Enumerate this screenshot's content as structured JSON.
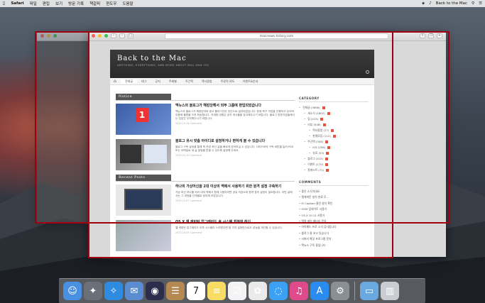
{
  "menubar": {
    "items": [
      "Safari",
      "파일",
      "편집",
      "보기",
      "방문 기록",
      "책갈피",
      "윈도우",
      "도움말"
    ],
    "clock": "Back to the Mac"
  },
  "window": {
    "url": "macnews.tistory.com"
  },
  "site": {
    "title": "Back to the Mac",
    "subtitle": "ANYTHING, EVERYTHING, AND MORE ABOUT MAC AND IOS",
    "nav": [
      "전체글",
      "태그",
      "공지",
      "주제별",
      "주간맥",
      "맥사용법",
      "주관적 iOS",
      "이벤트&안내"
    ],
    "notice_label": "Notice",
    "recent_label": "Recent Posts",
    "posts": [
      {
        "title": "맥뉴스의 블로그가 해킹당해서 외부 그룹에 편입되었습니다",
        "excerpt": "맥뉴스의 블로그가 해킹당하여 광고 플러그인이 무단으로 설치되었습니다. 현재 복구 작업을 진행하고 있으며 이용에 불편을 드려 죄송합니다. 자세한 내용은 공지 게시물을 참고해주시기 바랍니다. 블로그 방문자분들께서는 당분간 주의해주시기 바랍니다.",
        "meta": "2015.10.14 Comment"
      },
      {
        "title": "블로그 유시 맞춤 아이디로 설정하거나 편하게 볼 수 있습니다",
        "excerpt": "블로그 구독 설정을 통해 맥 관련 최신 글을 빠르게 받아보실 수 있습니다. 사이드바의 구독 버튼을 눌러 RSS 또는 이메일로 새 글 알림을 받을 수 있도록 설정해 주세요.",
        "meta": "2015.10.10 Comment"
      },
      {
        "title": "하나의 가상머신을 2대 이상의 맥에서 사용하기 위한 원격 설정 구축하기",
        "excerpt": "가상 머신 하나를 여러 대의 맥에서 함께 사용하려면 공유 저장소와 원격 접속 설정이 필요합니다. 이번 글에서는 그 과정을 단계별로 정리해 보았습니다.",
        "meta": "2015.10.07 Comment"
      },
      {
        "title": "OS X 엘 캐피탄 업그레이드 후 시스템 최적화 하기",
        "excerpt": "엘 캐피탄 업그레이드 이후 시스템이 느려졌다면 몇 가지 설정만으로도 성능을 개선할 수 있습니다.",
        "meta": "2015.10.05 Comment"
      }
    ],
    "category_label": "CATEGORY",
    "categories": [
      {
        "label": "전체글 (3698)",
        "indent": 0
      },
      {
        "label": "새소식 (1802)",
        "indent": 1
      },
      {
        "label": "팁 (415)",
        "indent": 1
      },
      {
        "label": "리뷰 (548)",
        "indent": 1
      },
      {
        "label": "맥사용법 (27)",
        "indent": 2
      },
      {
        "label": "판례모음 (111)",
        "indent": 2
      },
      {
        "label": "주간맥 (308)",
        "indent": 1
      },
      {
        "label": "iOS (256)",
        "indent": 2
      },
      {
        "label": "유료 (53)",
        "indent": 2
      },
      {
        "label": "블로그 (415)",
        "indent": 1
      },
      {
        "label": "이벤트 (170)",
        "indent": 1
      },
      {
        "label": "팟캐스트 (71)",
        "indent": 1
      }
    ],
    "comments_label": "COMMENTS",
    "comments": [
      "좋은 소식이네요",
      "엘캐피탄 설치 완료 후...",
      "El Capitan 클린 설치 확인",
      "iOS9 업데이트 사용기",
      "OS X 10.11 사용기",
      "맥북 에어 배터리 문의",
      "아이패드 프로 소식 감사합니다",
      "블로그 잘 보고 있습니다",
      "사파리 확장 프로그램 문의",
      "맥뉴스 구독 중입니다"
    ]
  },
  "dock": {
    "apps": [
      "finder-icon",
      "launchpad-icon",
      "safari-icon",
      "mail-icon",
      "siri-icon",
      "contacts-icon",
      "calendar-icon",
      "notes-icon",
      "reminders-icon",
      "photos-icon",
      "messages-icon",
      "itunes-icon",
      "appstore-icon",
      "preferences-icon",
      "folder-icon",
      "trash-icon"
    ],
    "calendar_day": "7"
  }
}
